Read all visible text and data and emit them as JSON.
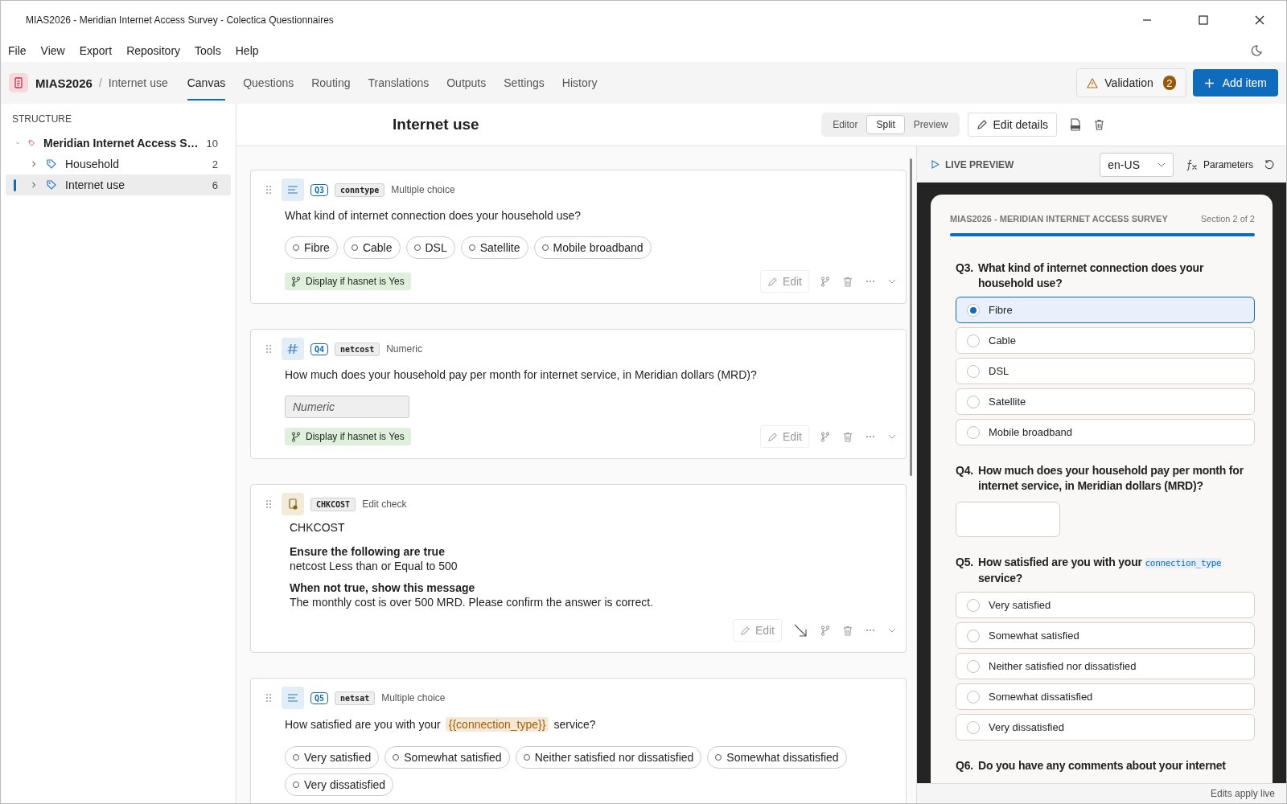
{
  "window": {
    "title": "MIAS2026 - Meridian Internet Access Survey - Colectica Questionnaires"
  },
  "menu": [
    "File",
    "View",
    "Export",
    "Repository",
    "Tools",
    "Help"
  ],
  "toolbar": {
    "code": "MIAS2026",
    "separator": "/",
    "crumb": "Internet use",
    "tabs": [
      {
        "label": "Canvas",
        "selected": true
      },
      {
        "label": "Questions",
        "selected": false
      },
      {
        "label": "Routing",
        "selected": false
      },
      {
        "label": "Translations",
        "selected": false
      },
      {
        "label": "Outputs",
        "selected": false
      },
      {
        "label": "Settings",
        "selected": false
      },
      {
        "label": "History",
        "selected": false
      }
    ],
    "validation": {
      "label": "Validation",
      "count": "2"
    },
    "add_item": "Add item"
  },
  "sidebar": {
    "heading": "STRUCTURE",
    "tree": [
      {
        "label": "Meridian Internet Access S…",
        "count": "10",
        "expanded": true,
        "selected": false,
        "children": [
          {
            "label": "Household",
            "count": "2",
            "expanded": false,
            "selected": false
          },
          {
            "label": "Internet use",
            "count": "6",
            "expanded": false,
            "selected": true
          }
        ]
      }
    ]
  },
  "canvas": {
    "title": "Internet use",
    "view_modes": [
      {
        "label": "Editor",
        "selected": false
      },
      {
        "label": "Split",
        "selected": true
      },
      {
        "label": "Preview",
        "selected": false
      }
    ],
    "edit_details": "Edit details",
    "items": [
      {
        "kind": "choice_question",
        "number": "Q3",
        "variable": "conntype",
        "type_label": "Multiple choice",
        "text": [
          {
            "kind": "text",
            "text": "What kind of internet connection does your household use?"
          }
        ],
        "options": [
          "Fibre",
          "Cable",
          "DSL",
          "Satellite",
          "Mobile broadband"
        ],
        "condition": "Display if hasnet is Yes",
        "action": "Edit"
      },
      {
        "kind": "numeric_question",
        "number": "Q4",
        "variable": "netcost",
        "type_label": "Numeric",
        "text": [
          {
            "kind": "text",
            "text": "How much does your household pay per month for internet service, in Meridian dollars (MRD)?"
          }
        ],
        "placeholder": "Numeric",
        "condition": "Display if hasnet is Yes",
        "action": "Edit"
      },
      {
        "kind": "check",
        "variable": "CHKCOST",
        "type_label": "Edit check",
        "title": "CHKCOST",
        "sections": [
          {
            "heading": "Ensure the following are true",
            "body": "netcost Less than or Equal to 500"
          },
          {
            "heading": "When not true, show this message",
            "body": "The monthly cost is over 500 MRD. Please confirm the answer is correct."
          }
        ],
        "action": "Edit"
      },
      {
        "kind": "choice_question",
        "number": "Q5",
        "variable": "netsat",
        "type_label": "Multiple choice",
        "text": [
          {
            "kind": "text",
            "text": "How satisfied are you with your"
          },
          {
            "kind": "token",
            "text": "{{connection_type}}"
          },
          {
            "kind": "text",
            "text": "service?"
          }
        ],
        "options": [
          "Very satisfied",
          "Somewhat satisfied",
          "Neither satisfied nor dissatisfied",
          "Somewhat dissatisfied",
          "Very dissatisfied"
        ]
      }
    ]
  },
  "preview": {
    "label": "LIVE PREVIEW",
    "language": "en-US",
    "parameters": "Parameters",
    "survey_title": "MIAS2026 - MERIDIAN INTERNET ACCESS SURVEY",
    "section": "Section 2 of 2",
    "level": 1,
    "questions": [
      {
        "kind": "choice",
        "number": "Q3.",
        "text": [
          {
            "kind": "text",
            "text": "What kind of internet connection does your household use?"
          }
        ],
        "options": [
          {
            "label": "Fibre",
            "selected": true
          },
          {
            "label": "Cable",
            "selected": false
          },
          {
            "label": "DSL",
            "selected": false
          },
          {
            "label": "Satellite",
            "selected": false
          },
          {
            "label": "Mobile broadband",
            "selected": false
          }
        ]
      },
      {
        "kind": "numeric",
        "number": "Q4.",
        "text": [
          {
            "kind": "text",
            "text": "How much does your household pay per month for internet service, in Meridian dollars (MRD)?"
          }
        ]
      },
      {
        "kind": "choice",
        "number": "Q5.",
        "text": [
          {
            "kind": "text",
            "text": "How satisfied are you with your "
          },
          {
            "kind": "token",
            "text": "connection_type"
          },
          {
            "kind": "text",
            "text": " service?"
          }
        ],
        "options": [
          {
            "label": "Very satisfied",
            "selected": false
          },
          {
            "label": "Somewhat satisfied",
            "selected": false
          },
          {
            "label": "Neither satisfied nor dissatisfied",
            "selected": false
          },
          {
            "label": "Somewhat dissatisfied",
            "selected": false
          },
          {
            "label": "Very dissatisfied",
            "selected": false
          }
        ]
      },
      {
        "kind": "text",
        "number": "Q6.",
        "text": [
          {
            "kind": "text",
            "text": "Do you have any comments about your internet"
          }
        ]
      }
    ],
    "status": "Edits apply live"
  }
}
